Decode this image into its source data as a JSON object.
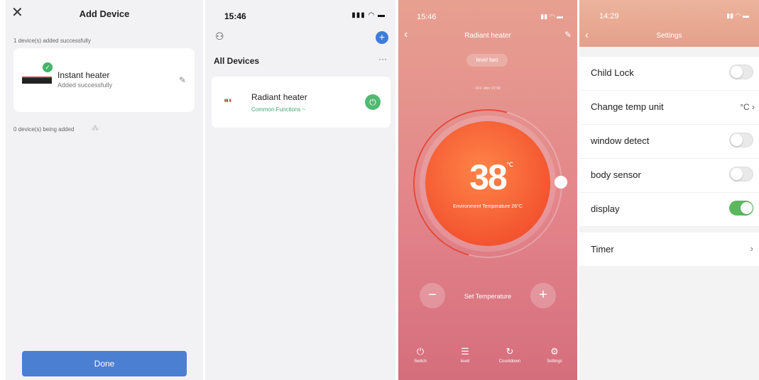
{
  "panel1": {
    "close_icon": "close-icon",
    "title": "Add Device",
    "added_count": "1 device(s) added successfully",
    "device": {
      "name": "Instant heater",
      "status": "Added successfully"
    },
    "adding_count": "0 device(s) being added",
    "done_label": "Done",
    "accent": "#4a7fd1"
  },
  "panel2": {
    "time": "15:46",
    "section_title": "All Devices",
    "more": "···",
    "device": {
      "name": "Radiant heater",
      "sub": "Common Functions ~",
      "brand": "Radiant heater"
    },
    "add_icon": "plus-circle-icon",
    "power_color": "#4dbb72"
  },
  "panel3": {
    "time": "15:46",
    "title": "Radiant heater",
    "level": "level two",
    "off_after": "OFF after 22:58",
    "temperature": "38",
    "unit": "℃",
    "environment": "Environment Temperature 26°C",
    "set_temperature": "Set Temperature",
    "minus": "−",
    "plus": "+",
    "tabs": [
      {
        "icon": "power-icon",
        "glyph": "⏻",
        "label": "Switch"
      },
      {
        "icon": "level-icon",
        "glyph": "☰",
        "label": "level"
      },
      {
        "icon": "countdown-icon",
        "glyph": "↻",
        "label": "Countdown"
      },
      {
        "icon": "settings-icon",
        "glyph": "⚙",
        "label": "Settings"
      }
    ]
  },
  "panel4": {
    "time": "14:29",
    "title": "Settings",
    "rows": [
      {
        "label": "Child Lock",
        "type": "toggle",
        "on": false
      },
      {
        "label": "Change temp unit",
        "type": "value",
        "value": "°C"
      },
      {
        "label": "window detect",
        "type": "toggle",
        "on": false
      },
      {
        "label": "body sensor",
        "type": "toggle",
        "on": false
      },
      {
        "label": "display",
        "type": "toggle",
        "on": true
      }
    ],
    "timer_label": "Timer"
  }
}
